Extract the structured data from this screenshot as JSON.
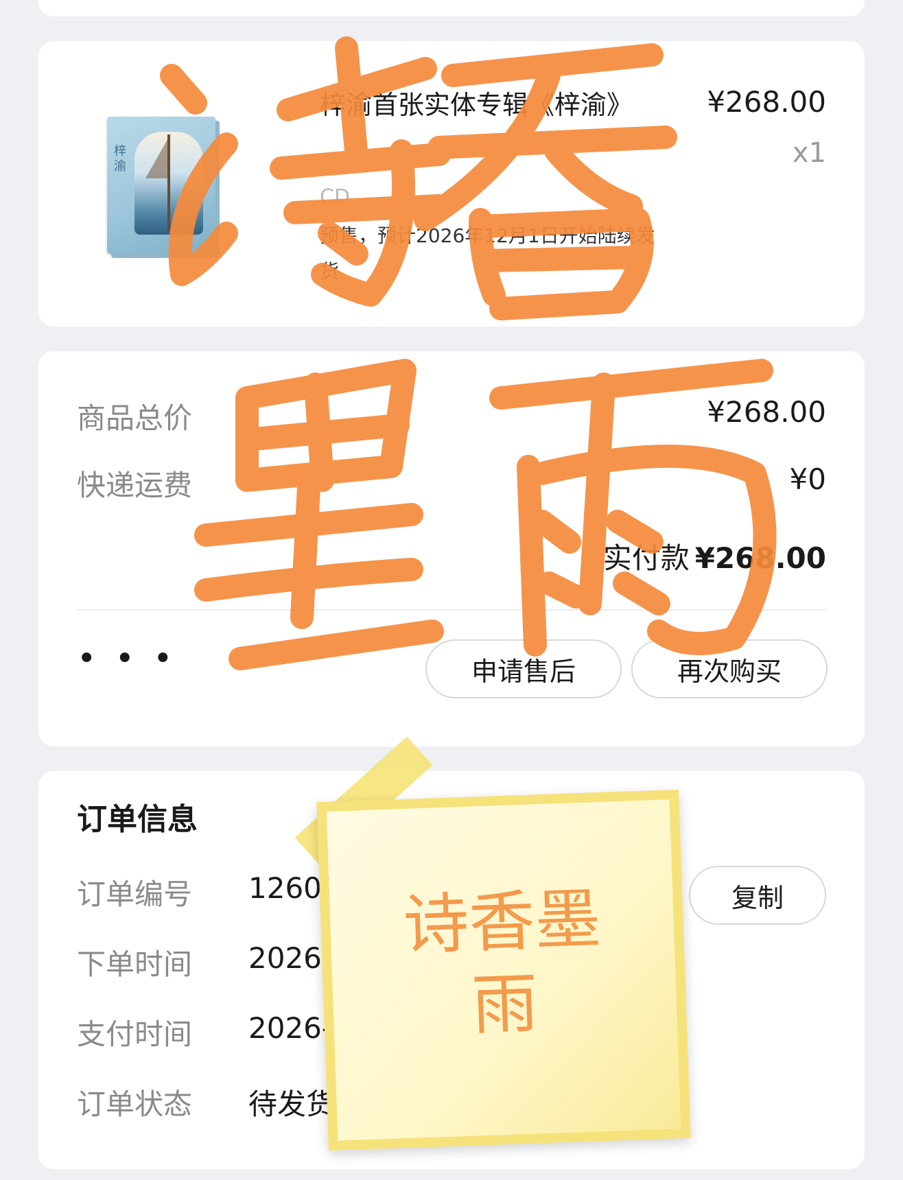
{
  "product": {
    "title": "梓渝首张实体专辑《梓渝》",
    "spec": "CD",
    "note": "预售，预计2026年12月1日开始陆续发货",
    "price": "¥268.00",
    "qty": "x1",
    "cover_text": "梓渝"
  },
  "pricing": {
    "goods_total_label": "商品总价",
    "goods_total_value": "¥268.00",
    "shipping_label": "快递运费",
    "shipping_value": "¥0",
    "paid_label": "实付款",
    "paid_value": "¥268.00",
    "more": "• • •",
    "aftersale_label": "申请售后",
    "rebuy_label": "再次购买"
  },
  "order_info": {
    "title": "订单信息",
    "order_no_label": "订单编号",
    "order_no_value": "1260901",
    "copy_label": "复制",
    "order_time_label": "下单时间",
    "order_time_value": "2026-09-01",
    "pay_time_label": "支付时间",
    "pay_time_value": "2026-09-01",
    "status_label": "订单状态",
    "status_value": "待发货"
  },
  "watermark": {
    "note_text": "诗香墨雨",
    "color": "#f58a3c"
  }
}
